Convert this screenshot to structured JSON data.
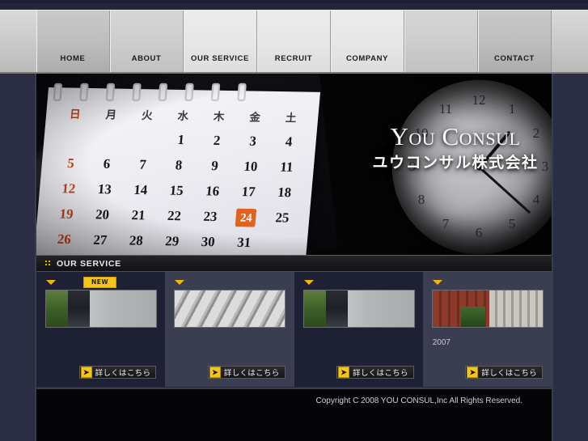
{
  "site": {
    "background_color": "#2b2e42",
    "accent_color": "#f5c518"
  },
  "nav": {
    "items": [
      {
        "label": "HOME",
        "tone": "t-dark"
      },
      {
        "label": "ABOUT",
        "tone": "t-mid"
      },
      {
        "label": "OUR SERVICE",
        "tone": "t-light"
      },
      {
        "label": "RECRUIT",
        "tone": "t-light"
      },
      {
        "label": "COMPANY",
        "tone": "t-light"
      },
      {
        "label": "",
        "tone": "t-mid"
      },
      {
        "label": "CONTACT",
        "tone": "t-dark"
      }
    ]
  },
  "hero": {
    "logo_en": "You Consul",
    "logo_jp": "ユウコンサル株式会社",
    "calendar": {
      "weekday_headers": [
        "日",
        "月",
        "火",
        "水",
        "木",
        "金",
        "土"
      ],
      "rows": [
        [
          "",
          "",
          "",
          "1",
          "2",
          "3",
          "4"
        ],
        [
          "5",
          "6",
          "7",
          "8",
          "9",
          "10",
          "11"
        ],
        [
          "12",
          "13",
          "14",
          "15",
          "16",
          "17",
          "18"
        ],
        [
          "19",
          "20",
          "21",
          "22",
          "23",
          "24",
          "25"
        ],
        [
          "26",
          "27",
          "28",
          "29",
          "30",
          "31",
          ""
        ]
      ],
      "highlighted_day": "24",
      "highlight_color": "#e2611d"
    },
    "clock": {
      "numerals": [
        "12",
        "1",
        "2",
        "3",
        "4",
        "5",
        "6",
        "7",
        "8",
        "9",
        "10",
        "11"
      ]
    }
  },
  "service_section": {
    "title": "OUR SERVICE",
    "prefix": "::",
    "cards": [
      {
        "badge": "NEW",
        "year": "",
        "button_label": "詳しくはこちら",
        "button_arrow": "➤",
        "thumb": "walkway",
        "tone": "alt-a"
      },
      {
        "badge": "",
        "year": "",
        "button_label": "詳しくはこちら",
        "button_arrow": "➤",
        "thumb": "keyboard",
        "tone": "alt-b"
      },
      {
        "badge": "",
        "year": "",
        "button_label": "詳しくはこちら",
        "button_arrow": "➤",
        "thumb": "walkway",
        "tone": "alt-a"
      },
      {
        "badge": "",
        "year": "2007",
        "button_label": "詳しくはこちら",
        "button_arrow": "➤",
        "thumb": "buildings",
        "tone": "alt-b"
      }
    ]
  },
  "footer": {
    "copyright": "Copyright C 2008 YOU CONSUL,Inc All Rights Reserved."
  }
}
